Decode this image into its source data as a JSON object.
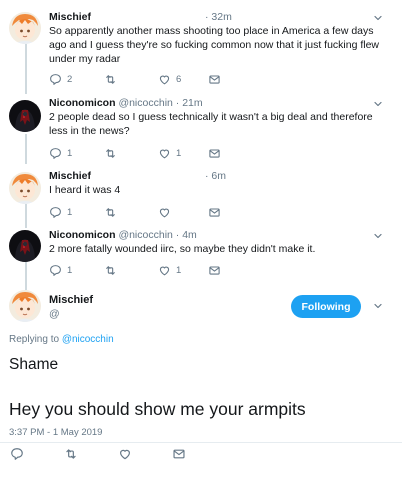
{
  "tweets": [
    {
      "name": "Mischief",
      "handle": "",
      "time": "· 32m",
      "text": "So apparently another mass shooting too place in America a few days ago and I guess they're so fucking common now that it just fucking flew under my radar",
      "reply_count": "2",
      "retweet_count": "",
      "like_count": "6"
    },
    {
      "name": "Niconomicon",
      "handle": "@nicocchin · 21m",
      "text": "2 people dead so I guess technically it wasn't a big deal and therefore less in the news?",
      "reply_count": "1",
      "retweet_count": "",
      "like_count": "1"
    },
    {
      "name": "Mischief",
      "handle": "",
      "time": "· 6m",
      "text": "I heard it was 4",
      "reply_count": "1",
      "retweet_count": "",
      "like_count": ""
    },
    {
      "name": "Niconomicon",
      "handle": "@nicocchin · 4m",
      "text": "2 more fatally wounded iirc, so maybe they didn't make it.",
      "reply_count": "1",
      "retweet_count": "",
      "like_count": "1"
    }
  ],
  "main": {
    "name": "Mischief",
    "handle": "@",
    "follow_label": "Following",
    "replying_prefix": "Replying to",
    "replying_handle": "@nicocchin",
    "line1": "Shame",
    "line2": "Hey you should show me your armpits",
    "timestamp": "3:37 PM - 1 May 2019"
  },
  "colors": {
    "accent": "#1da1f2",
    "text": "#14171a",
    "muted": "#657786",
    "thread_line": "#cfd9de"
  },
  "icons": [
    "reply-icon",
    "retweet-icon",
    "like-icon",
    "message-icon",
    "chevron-down-icon"
  ]
}
